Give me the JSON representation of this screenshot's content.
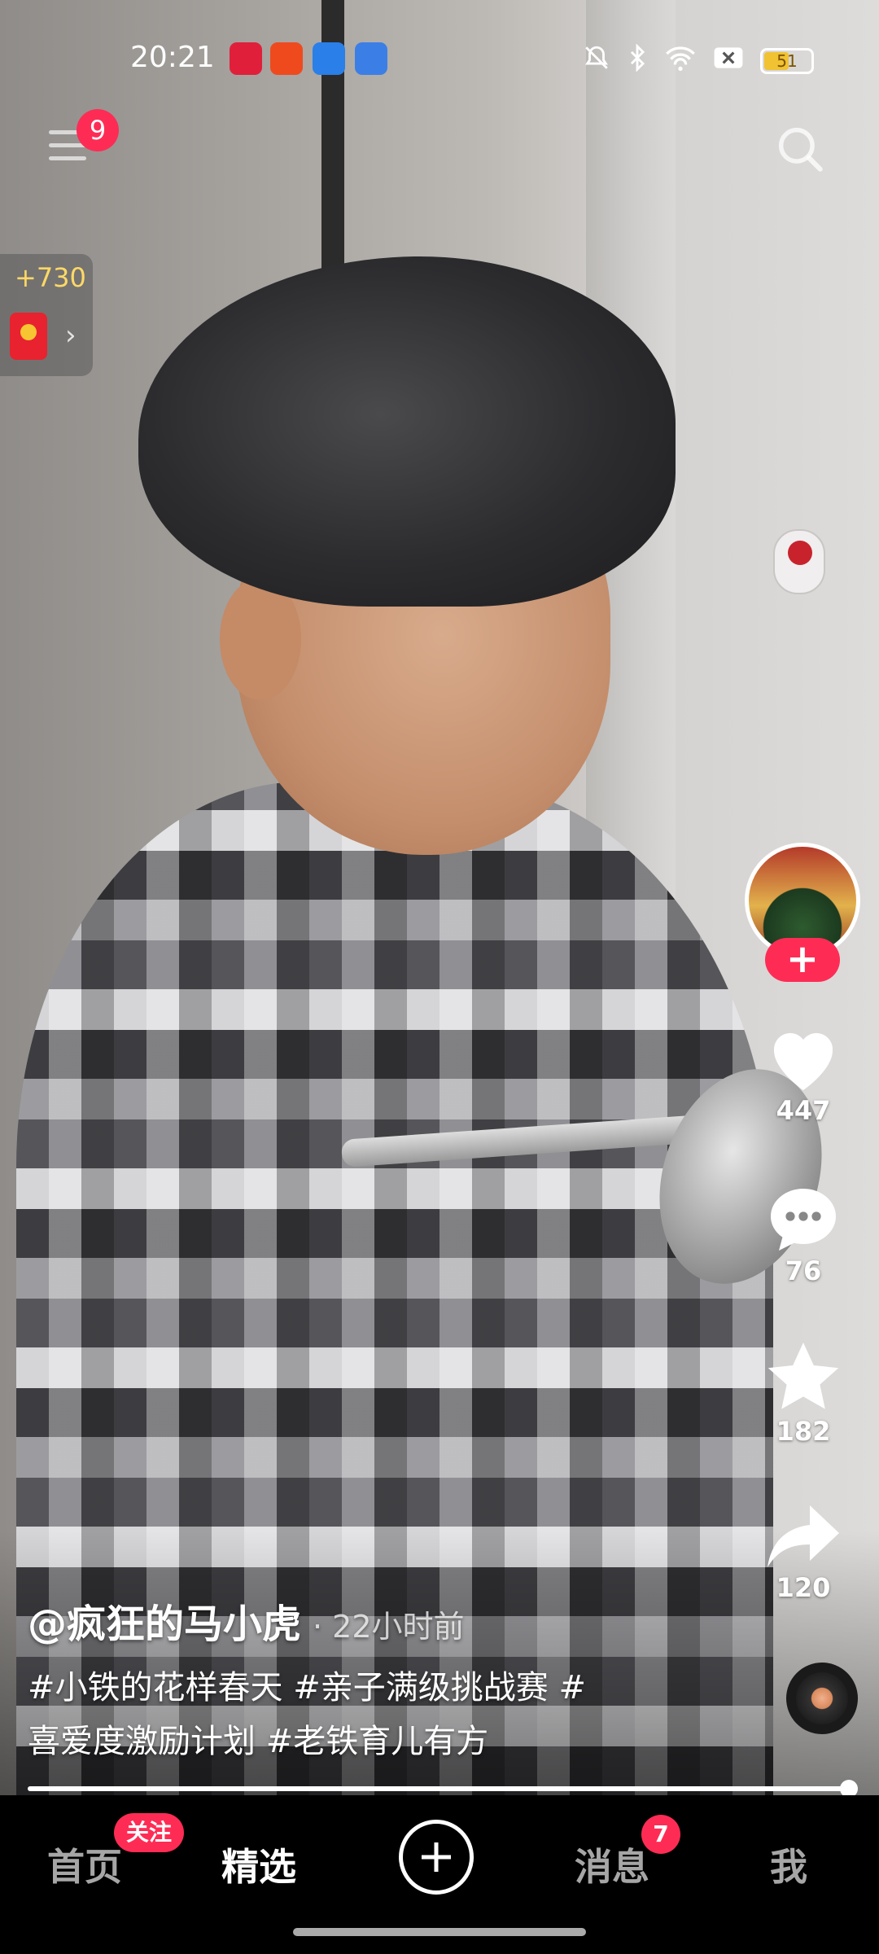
{
  "status_bar": {
    "time": "20:21",
    "battery": "51",
    "icons": [
      "bell-off-icon",
      "bluetooth-icon",
      "wifi-icon",
      "sim-off-icon"
    ]
  },
  "top": {
    "menu_badge": "9"
  },
  "reward": {
    "amount": "+730",
    "chevron": "›"
  },
  "rail": {
    "follow_plus": "+",
    "likes": "447",
    "comments": "76",
    "favorites": "182",
    "shares": "120"
  },
  "post": {
    "author": "@疯狂的马小虎",
    "time_ago": "· 22小时前",
    "caption_line1": "#小铁的花样春天 #亲子满级挑战赛 #",
    "caption_line2": "喜爱度激励计划 #老铁育儿有方"
  },
  "playback": {
    "progress": 1.0
  },
  "nav": {
    "home": "首页",
    "home_badge": "关注",
    "featured": "精选",
    "messages": "消息",
    "messages_badge": "7",
    "me": "我"
  },
  "colors": {
    "accent": "#fe2c55",
    "reward_amount": "#ffd966"
  }
}
